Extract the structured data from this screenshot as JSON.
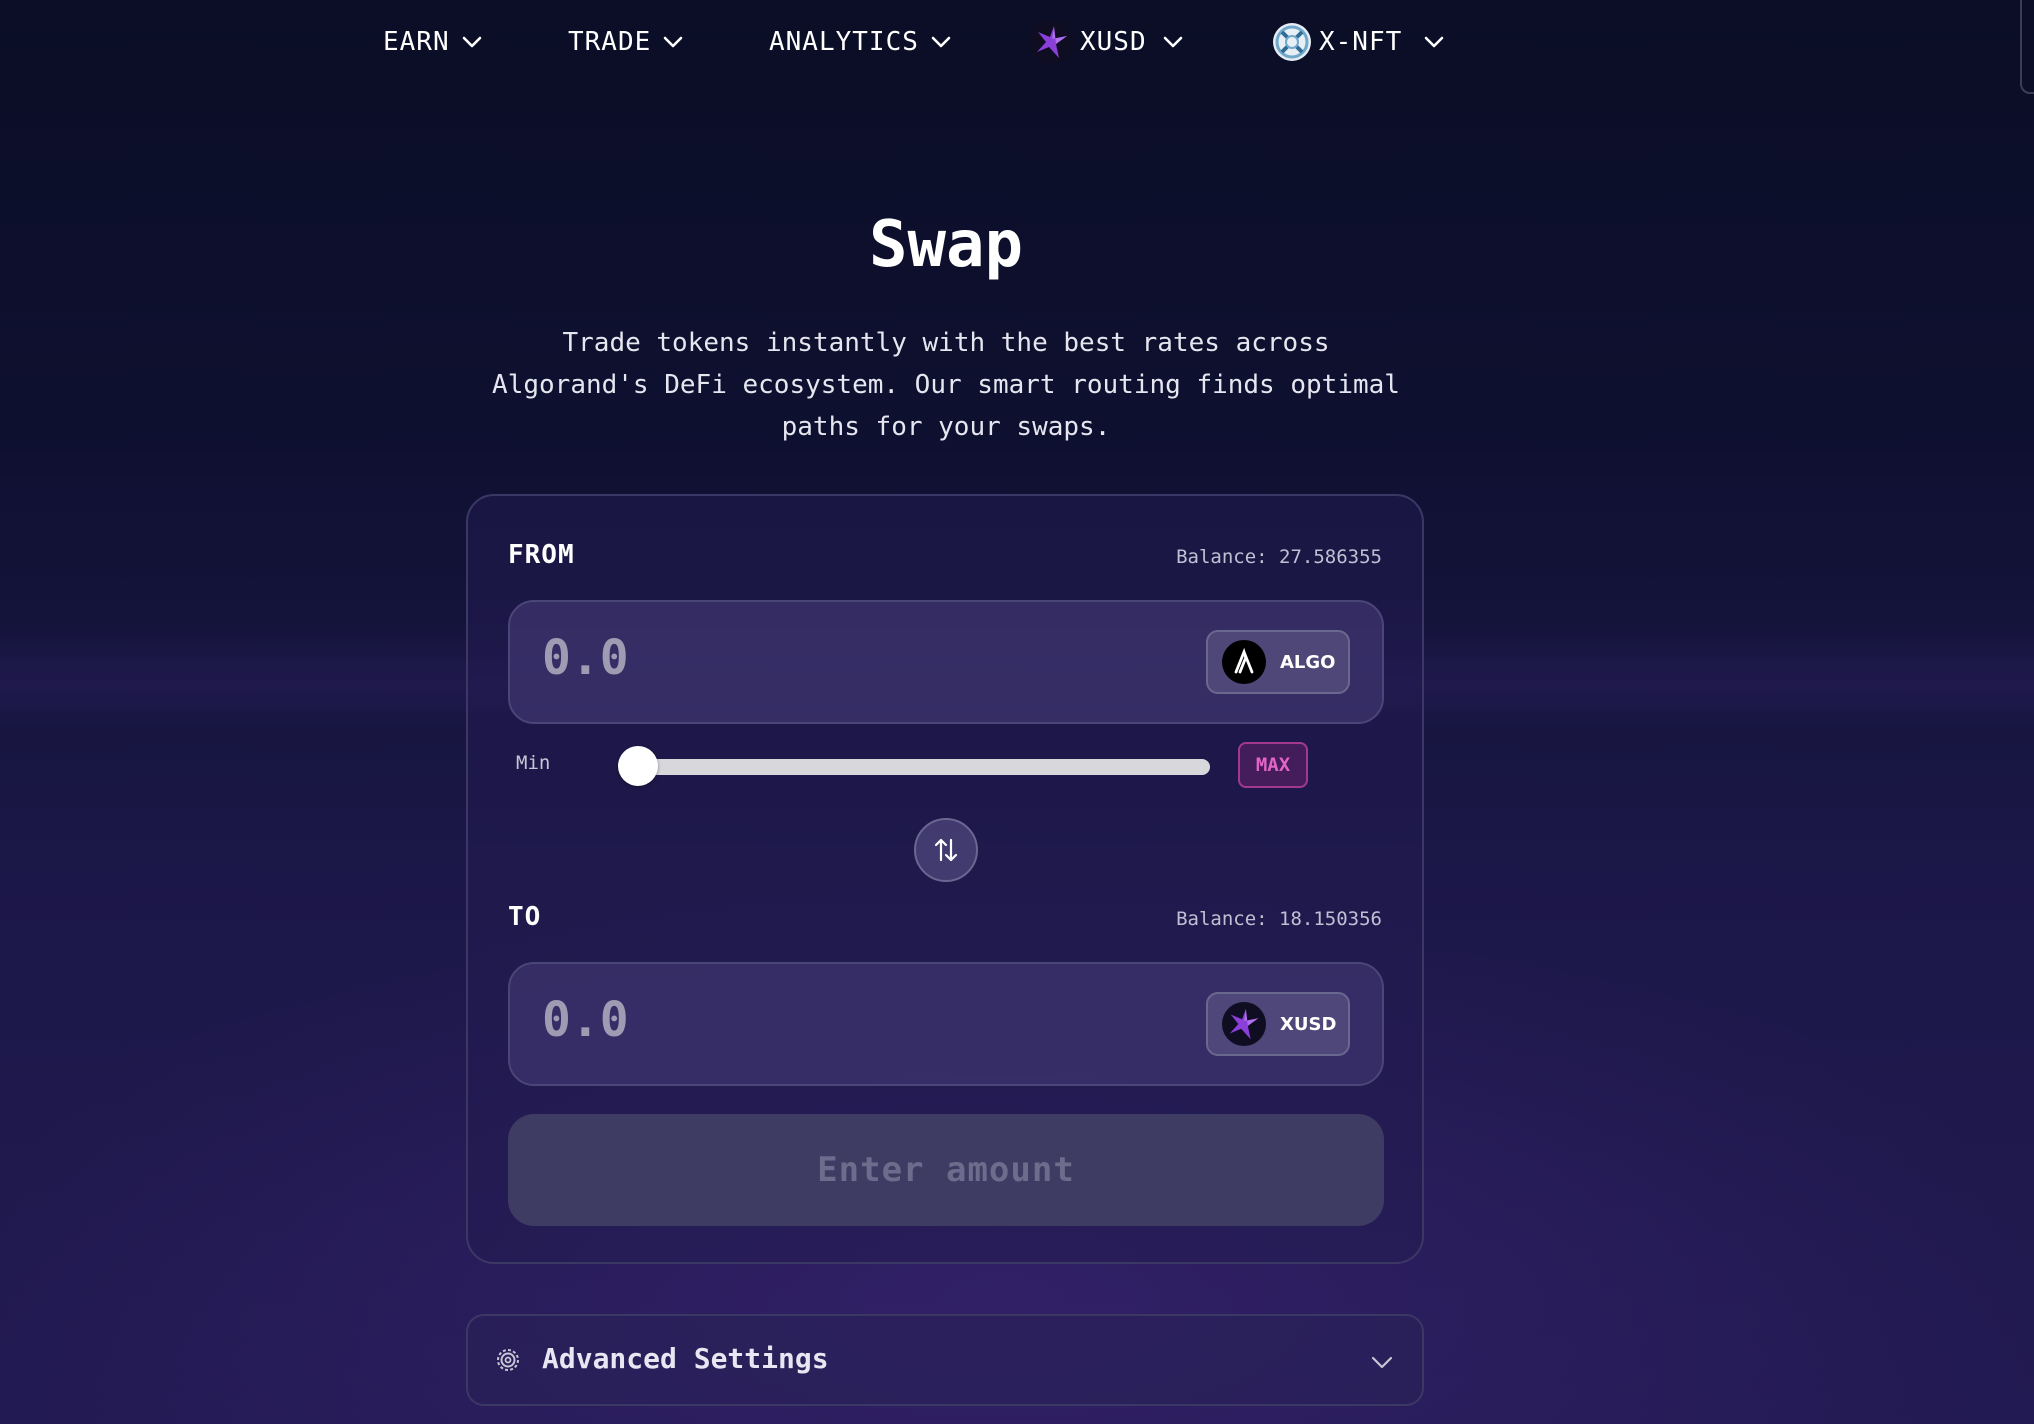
{
  "nav": {
    "items": [
      {
        "label": "EARN"
      },
      {
        "label": "TRADE"
      },
      {
        "label": "ANALYTICS"
      },
      {
        "label": "XUSD",
        "icon": "xusd-logo-icon"
      },
      {
        "label": "X-NFT",
        "icon": "x-nft-logo-icon"
      }
    ]
  },
  "hero": {
    "title": "Swap",
    "subtitle_lines": [
      "Trade tokens instantly with the best rates across",
      "Algorand's DeFi ecosystem. Our smart routing finds optimal",
      "paths for your swaps."
    ]
  },
  "swap": {
    "from": {
      "label": "FROM",
      "balance": "Balance: 27.586355",
      "amount_placeholder": "0.0",
      "token": "ALGO",
      "token_icon": "algo-logo-icon"
    },
    "slider": {
      "min_label": "Min",
      "max_label": "MAX",
      "value": 0
    },
    "direction_icon": "swap-arrows-icon",
    "to": {
      "label": "TO",
      "balance": "Balance: 18.150356",
      "amount_placeholder": "0.0",
      "token": "XUSD",
      "token_icon": "xusd-logo-icon"
    },
    "submit_label": "Enter amount"
  },
  "advanced": {
    "label": "Advanced Settings",
    "icon": "gear-icon"
  },
  "colors": {
    "accent_pink": "#e264c8",
    "xusd_purple": "#8b3fd9",
    "card_border": "#3b3866"
  }
}
